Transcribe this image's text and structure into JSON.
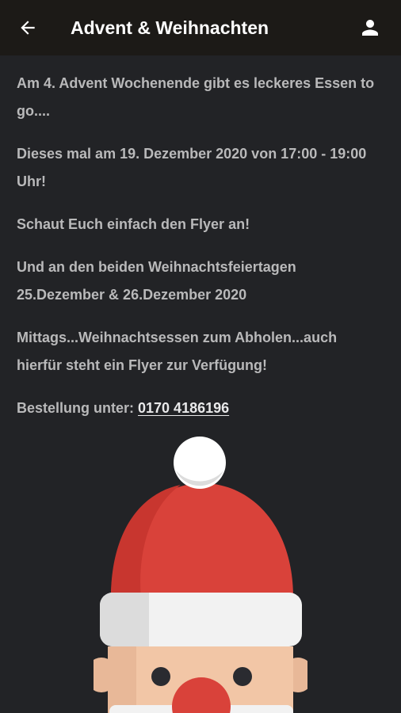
{
  "appbar": {
    "title": "Advent & Weihnachten",
    "back_icon": "arrow-left-icon",
    "profile_icon": "person-icon"
  },
  "content": {
    "paragraphs": [
      "Am 4. Advent Wochenende gibt es leckeres Essen to go....",
      "Dieses mal am 19. Dezember 2020 von 17:00 - 19:00 Uhr!",
      "Schaut Euch einfach den Flyer an!",
      "Und an den beiden Weihnachtsfeiertagen 25.Dezember & 26.Dezember 2020",
      "Mittags...Weihnachtsessen zum Abholen...auch hierfür steht ein Flyer zur Verfügung!"
    ],
    "order_label": "Bestellung unter: ",
    "phone": "0170 4186196"
  },
  "colors": {
    "background": "#222326",
    "appbar": "#1c1a17",
    "text": "#b9b9ba",
    "hat_red": "#d9423a",
    "skin": "#f2c6a6"
  }
}
